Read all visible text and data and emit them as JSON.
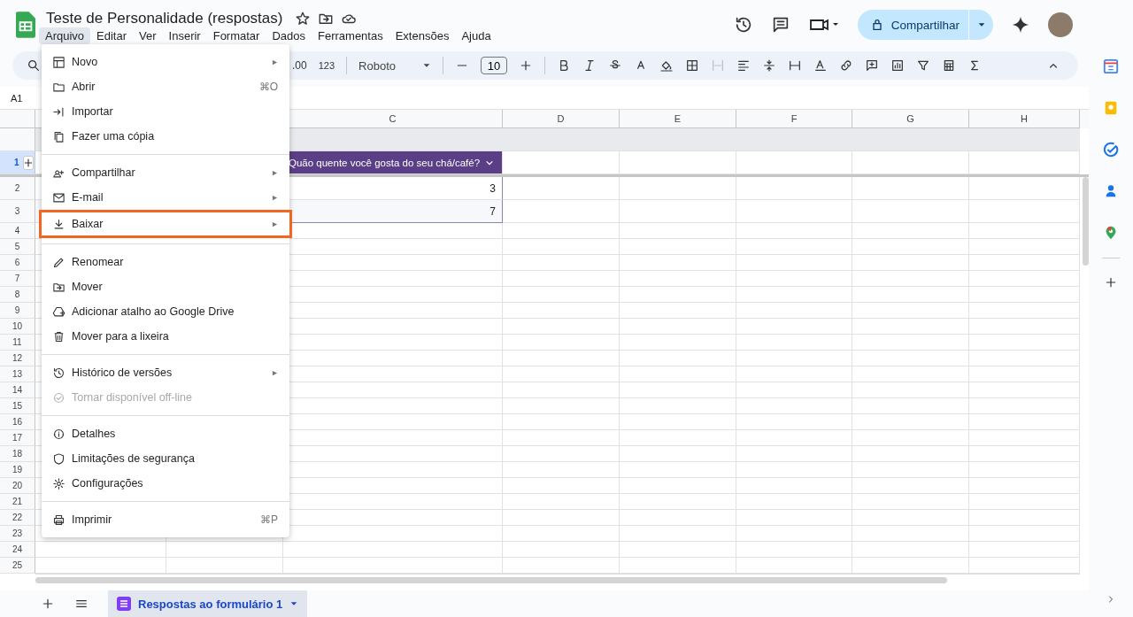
{
  "document": {
    "title": "Teste de Personalidade (respostas)"
  },
  "menubar": [
    {
      "label": "Arquivo",
      "selected": true
    },
    {
      "label": "Editar",
      "selected": false
    },
    {
      "label": "Ver",
      "selected": false
    },
    {
      "label": "Inserir",
      "selected": false
    },
    {
      "label": "Formatar",
      "selected": false
    },
    {
      "label": "Dados",
      "selected": false
    },
    {
      "label": "Ferramentas",
      "selected": false
    },
    {
      "label": "Extensões",
      "selected": false
    },
    {
      "label": "Ajuda",
      "selected": false
    }
  ],
  "share_button": "Compartilhar",
  "toolbar": {
    "decimal_format": ".00",
    "more_formats": "123",
    "font": "Roboto",
    "font_size": "10"
  },
  "name_box": "A1",
  "columns": [
    "C",
    "D",
    "E",
    "F",
    "G",
    "H"
  ],
  "row_numbers": [
    {
      "label": "1",
      "selected": true
    },
    {
      "label": "2",
      "selected": false
    },
    {
      "label": "3",
      "selected": false
    },
    {
      "label": "4",
      "selected": false
    },
    {
      "label": "5",
      "selected": false
    },
    {
      "label": "6",
      "selected": false
    },
    {
      "label": "7",
      "selected": false
    },
    {
      "label": "8",
      "selected": false
    },
    {
      "label": "9",
      "selected": false
    },
    {
      "label": "10",
      "selected": false
    },
    {
      "label": "11",
      "selected": false
    },
    {
      "label": "12",
      "selected": false
    },
    {
      "label": "13",
      "selected": false
    },
    {
      "label": "14",
      "selected": false
    },
    {
      "label": "15",
      "selected": false
    },
    {
      "label": "16",
      "selected": false
    },
    {
      "label": "17",
      "selected": false
    },
    {
      "label": "18",
      "selected": false
    },
    {
      "label": "19",
      "selected": false
    },
    {
      "label": "20",
      "selected": false
    },
    {
      "label": "21",
      "selected": false
    },
    {
      "label": "22",
      "selected": false
    },
    {
      "label": "23",
      "selected": false
    },
    {
      "label": "24",
      "selected": false
    },
    {
      "label": "25",
      "selected": false
    }
  ],
  "table": {
    "header": "Quão quente você gosta do seu chá/café?",
    "values": [
      "3",
      "7"
    ]
  },
  "file_menu": [
    [
      {
        "label": "Novo",
        "submenu": true,
        "disabled": false,
        "highlighted": false
      },
      {
        "label": "Abrir",
        "shortcut": "⌘O",
        "submenu": false,
        "disabled": false,
        "highlighted": false
      },
      {
        "label": "Importar",
        "submenu": false,
        "disabled": false,
        "highlighted": false
      },
      {
        "label": "Fazer uma cópia",
        "submenu": false,
        "disabled": false,
        "highlighted": false
      }
    ],
    [
      {
        "label": "Compartilhar",
        "submenu": true,
        "disabled": false,
        "highlighted": false
      },
      {
        "label": "E-mail",
        "submenu": true,
        "disabled": false,
        "highlighted": false
      },
      {
        "label": "Baixar",
        "submenu": true,
        "disabled": false,
        "highlighted": true
      }
    ],
    [
      {
        "label": "Renomear",
        "submenu": false,
        "disabled": false,
        "highlighted": false
      },
      {
        "label": "Mover",
        "submenu": false,
        "disabled": false,
        "highlighted": false
      },
      {
        "label": "Adicionar atalho ao Google Drive",
        "submenu": false,
        "disabled": false,
        "highlighted": false
      },
      {
        "label": "Mover para a lixeira",
        "submenu": false,
        "disabled": false,
        "highlighted": false
      }
    ],
    [
      {
        "label": "Histórico de versões",
        "submenu": true,
        "disabled": false,
        "highlighted": false
      },
      {
        "label": "Tornar disponível off-line",
        "submenu": false,
        "disabled": true,
        "highlighted": false
      }
    ],
    [
      {
        "label": "Detalhes",
        "submenu": false,
        "disabled": false,
        "highlighted": false
      },
      {
        "label": "Limitações de segurança",
        "submenu": false,
        "disabled": false,
        "highlighted": false
      },
      {
        "label": "Configurações",
        "submenu": false,
        "disabled": false,
        "highlighted": false
      }
    ],
    [
      {
        "label": "Imprimir",
        "shortcut": "⌘P",
        "submenu": false,
        "disabled": false,
        "highlighted": false
      }
    ]
  ],
  "sheet_tabs": [
    {
      "label": "Respostas ao formulário 1",
      "selected": true
    }
  ]
}
